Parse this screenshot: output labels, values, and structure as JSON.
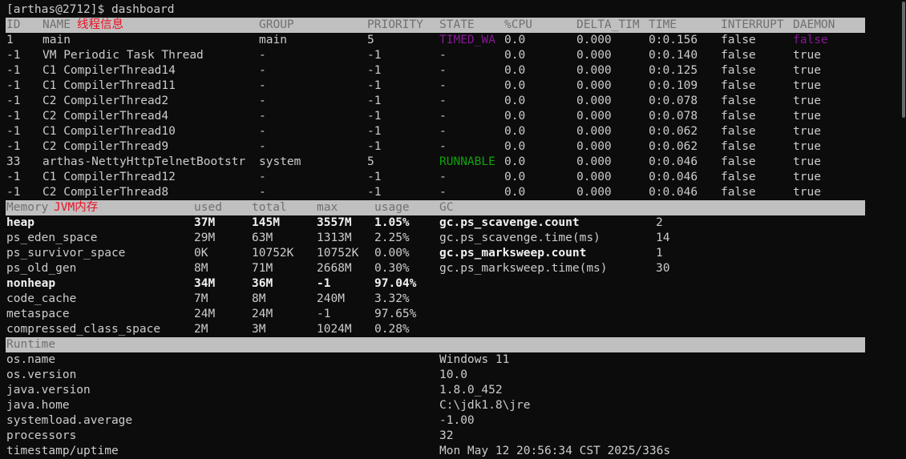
{
  "prompt": "[arthas@2712]$ dashboard",
  "thread": {
    "headers": [
      "ID",
      "NAME",
      "GROUP",
      "PRIORITY",
      "STATE",
      "%CPU",
      "DELTA_TIM",
      "TIME",
      "INTERRUPT",
      "DAEMON"
    ],
    "annotation": "线程信息",
    "rows": [
      [
        "1",
        "main",
        "main",
        "5",
        "TIMED_WA",
        "0.0",
        "0.000",
        "0:0.156",
        "false",
        "false"
      ],
      [
        "-1",
        "VM Periodic Task Thread",
        "-",
        "-1",
        "-",
        "0.0",
        "0.000",
        "0:0.140",
        "false",
        "true"
      ],
      [
        "-1",
        "C1 CompilerThread14",
        "-",
        "-1",
        "-",
        "0.0",
        "0.000",
        "0:0.125",
        "false",
        "true"
      ],
      [
        "-1",
        "C1 CompilerThread11",
        "-",
        "-1",
        "-",
        "0.0",
        "0.000",
        "0:0.109",
        "false",
        "true"
      ],
      [
        "-1",
        "C2 CompilerThread2",
        "-",
        "-1",
        "-",
        "0.0",
        "0.000",
        "0:0.078",
        "false",
        "true"
      ],
      [
        "-1",
        "C2 CompilerThread4",
        "-",
        "-1",
        "-",
        "0.0",
        "0.000",
        "0:0.078",
        "false",
        "true"
      ],
      [
        "-1",
        "C1 CompilerThread10",
        "-",
        "-1",
        "-",
        "0.0",
        "0.000",
        "0:0.062",
        "false",
        "true"
      ],
      [
        "-1",
        "C2 CompilerThread9",
        "-",
        "-1",
        "-",
        "0.0",
        "0.000",
        "0:0.062",
        "false",
        "true"
      ],
      [
        "33",
        "arthas-NettyHttpTelnetBootstr",
        "system",
        "5",
        "RUNNABLE",
        "0.0",
        "0.000",
        "0:0.046",
        "false",
        "true"
      ],
      [
        "-1",
        "C1 CompilerThread12",
        "-",
        "-1",
        "-",
        "0.0",
        "0.000",
        "0:0.046",
        "false",
        "true"
      ],
      [
        "-1",
        "C2 CompilerThread8",
        "-",
        "-1",
        "-",
        "0.0",
        "0.000",
        "0:0.046",
        "false",
        "true"
      ]
    ]
  },
  "memory": {
    "headers": [
      "Memory",
      "used",
      "total",
      "max",
      "usage",
      "GC"
    ],
    "annotation": "JVM内存",
    "rows": [
      [
        "heap",
        "37M",
        "145M",
        "3557M",
        "1.05%"
      ],
      [
        "ps_eden_space",
        "29M",
        "63M",
        "1313M",
        "2.25%"
      ],
      [
        "ps_survivor_space",
        "0K",
        "10752K",
        "10752K",
        "0.00%"
      ],
      [
        "ps_old_gen",
        "8M",
        "71M",
        "2668M",
        "0.30%"
      ],
      [
        "nonheap",
        "34M",
        "36M",
        "-1",
        "97.04%"
      ],
      [
        "code_cache",
        "7M",
        "8M",
        "240M",
        "3.32%"
      ],
      [
        "metaspace",
        "24M",
        "24M",
        "-1",
        "97.65%"
      ],
      [
        "compressed_class_space",
        "2M",
        "3M",
        "1024M",
        "0.28%"
      ]
    ],
    "gc": [
      [
        "gc.ps_scavenge.count",
        "2"
      ],
      [
        "gc.ps_scavenge.time(ms)",
        "14"
      ],
      [
        "gc.ps_marksweep.count",
        "1"
      ],
      [
        "gc.ps_marksweep.time(ms)",
        "30"
      ]
    ]
  },
  "runtime": {
    "header": "Runtime",
    "rows": [
      [
        "os.name",
        "Windows 11"
      ],
      [
        "os.version",
        "10.0"
      ],
      [
        "java.version",
        "1.8.0_452"
      ],
      [
        "java.home",
        "C:\\jdk1.8\\jre"
      ],
      [
        "systemload.average",
        "-1.00"
      ],
      [
        "processors",
        "32"
      ],
      [
        "timestamp/uptime",
        "Mon May 12 20:56:34 CST 2025/336s"
      ]
    ]
  },
  "colors": {
    "background": "#0c0c0c",
    "text": "#cccccc",
    "header_bar": "#c0c0c0",
    "annotation": "#e81123",
    "timed_waiting": "#881798",
    "runnable": "#13a10e"
  }
}
